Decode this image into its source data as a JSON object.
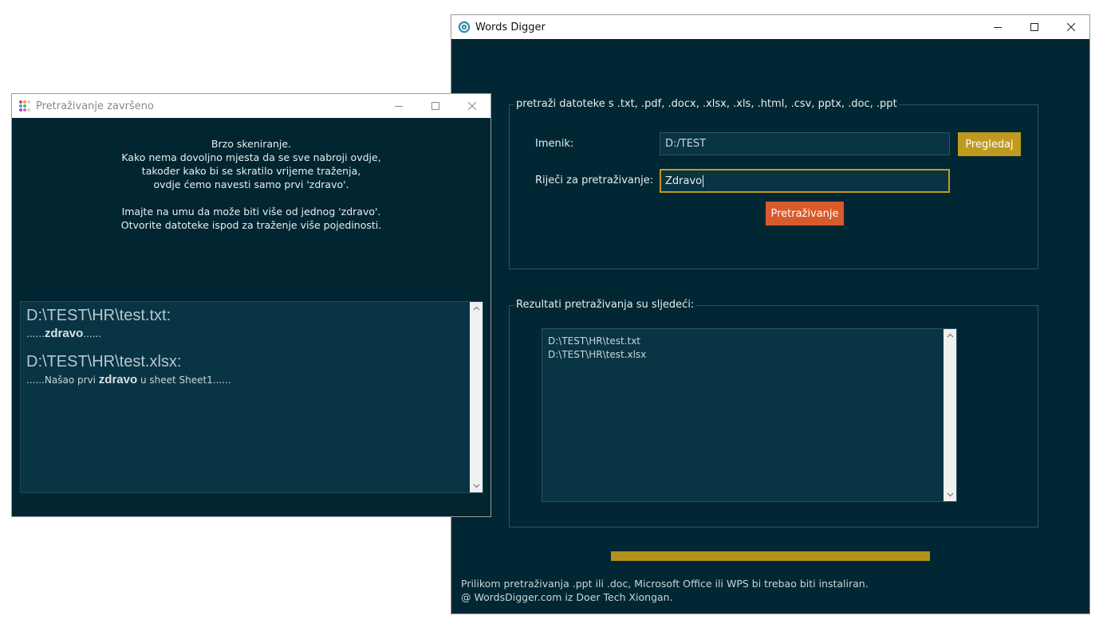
{
  "main_window": {
    "title": "Words Digger",
    "file_types_legend": "pretraži datoteke s .txt, .pdf, .docx, .xlsx, .xls, .html, .csv, pptx, .doc, .ppt",
    "directory_label": "Imenik:",
    "directory_value": "D:/TEST",
    "browse_label": "Pregledaj",
    "search_words_label": "Riječi za pretraživanje:",
    "search_words_value": "Zdravo",
    "search_button_label": "Pretraživanje",
    "results_legend": "Rezultati pretraživanja su sljedeći:",
    "results": [
      "D:\\TEST\\HR\\test.txt",
      "D:\\TEST\\HR\\test.xlsx"
    ],
    "progress": 1.0,
    "footer_note": "Prilikom pretraživanja .ppt ili .doc, Microsoft Office ili WPS bi trebao biti instaliran.",
    "footer_copyright": "@ WordsDigger.com iz Doer Tech Xiongan."
  },
  "dialog": {
    "title": "Pretraživanje završeno",
    "message_lines": [
      "Brzo skeniranje.",
      "Kako nema dovoljno mjesta da se sve nabroji ovdje,",
      "također kako bi se skratilo vrijeme traženja,",
      "ovdje ćemo navesti samo prvi 'zdravo'.",
      "",
      "Imajte na umu da može biti više od jednog 'zdravo'.",
      "Otvorite datoteke ispod za traženje više pojedinosti."
    ],
    "details": [
      {
        "path": "D:\\TEST\\HR\\test.txt:",
        "prefix": "......",
        "keyword": "zdravo",
        "suffix": "......"
      },
      {
        "path": "D:\\TEST\\HR\\test.xlsx:",
        "prefix": "......Našao prvi ",
        "keyword": "zdravo",
        "suffix": " u sheet Sheet1......"
      }
    ]
  },
  "colors": {
    "background": "#002733",
    "accent_gold": "#c09a1e",
    "search_button": "#d95a2b",
    "progress": "#b5901b"
  },
  "icons": {
    "main_window": "words-digger-app-icon",
    "dialog": "dots-app-icon"
  }
}
